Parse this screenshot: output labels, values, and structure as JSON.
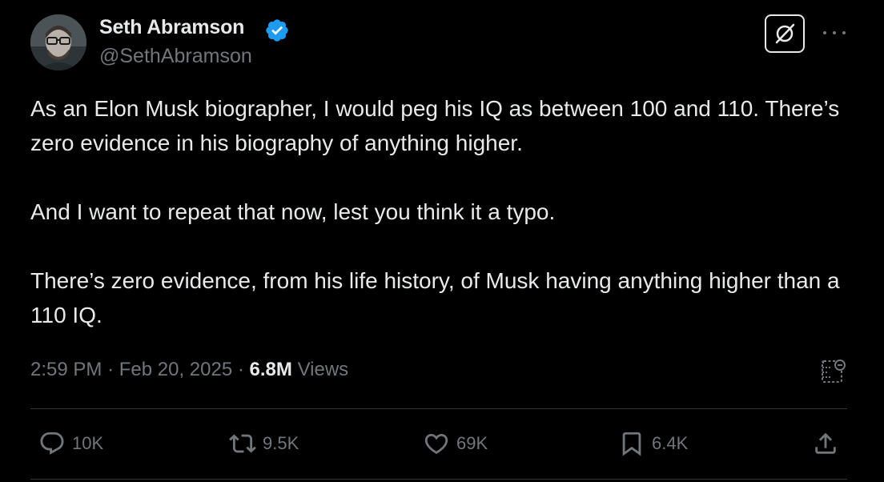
{
  "author": {
    "display_name": "Seth Abramson",
    "handle": "@SethAbramson",
    "verified_icon": "verified-badge-icon",
    "verified_color": "#1d9bf0"
  },
  "tweet": {
    "paragraphs": [
      "As an Elon Musk biographer, I would peg his IQ as between 100 and 110. There’s zero evidence in his biography of anything higher.",
      "And I want to repeat that now, lest you think it a typo.",
      "There’s zero evidence, from his life history, of Musk having anything higher than a 110 IQ."
    ]
  },
  "meta": {
    "time": "2:59 PM",
    "separator": "·",
    "date": "Feb 20, 2025",
    "views_count": "6.8M",
    "views_label": "Views"
  },
  "actions": {
    "replies": "10K",
    "reposts": "9.5K",
    "likes": "69K",
    "bookmarks": "6.4K"
  },
  "icons": {
    "grok": "grok-icon",
    "more": "more-options-icon",
    "translate": "translate-icon",
    "reply": "reply-icon",
    "repost": "repost-icon",
    "like": "heart-icon",
    "bookmark": "bookmark-icon",
    "share": "share-icon"
  },
  "colors": {
    "background": "#000000",
    "primary_text": "#e7e9ea",
    "secondary_text": "#71767b",
    "divider": "#2f3336"
  }
}
